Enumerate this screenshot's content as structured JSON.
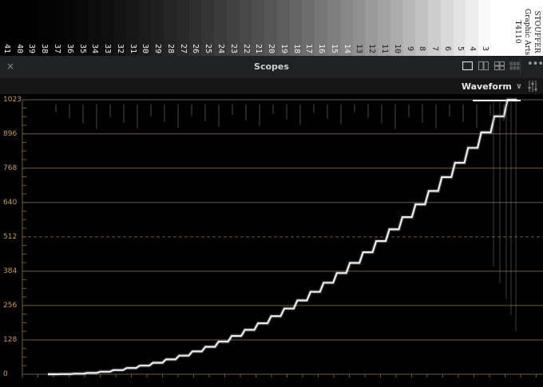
{
  "wedge": {
    "labels": [
      "41",
      "40",
      "39",
      "38",
      "37",
      "36",
      "35",
      "34",
      "33",
      "32",
      "31",
      "30",
      "29",
      "28",
      "27",
      "26",
      "25",
      "24",
      "23",
      "22",
      "21",
      "20",
      "19",
      "18",
      "17",
      "16",
      "15",
      "14",
      "13",
      "12",
      "11",
      "10",
      "9",
      "8",
      "7",
      "6",
      "5",
      "4",
      "3"
    ],
    "brand": {
      "line1": "STOUFFER",
      "line2": "Graphic Arts",
      "line3": "T4110"
    }
  },
  "panel": {
    "title": "Scopes",
    "close_glyph": "×",
    "menu_glyph": "•••",
    "scope_type": "Waveform",
    "chevron_glyph": "∨"
  },
  "waveform": {
    "scale": [
      1023,
      896,
      768,
      640,
      512,
      384,
      256,
      128,
      0
    ],
    "midline_value": 512,
    "colors": {
      "grid": "#6d5a3a",
      "label": "#c89b55",
      "trace": "#ffffff"
    }
  }
}
